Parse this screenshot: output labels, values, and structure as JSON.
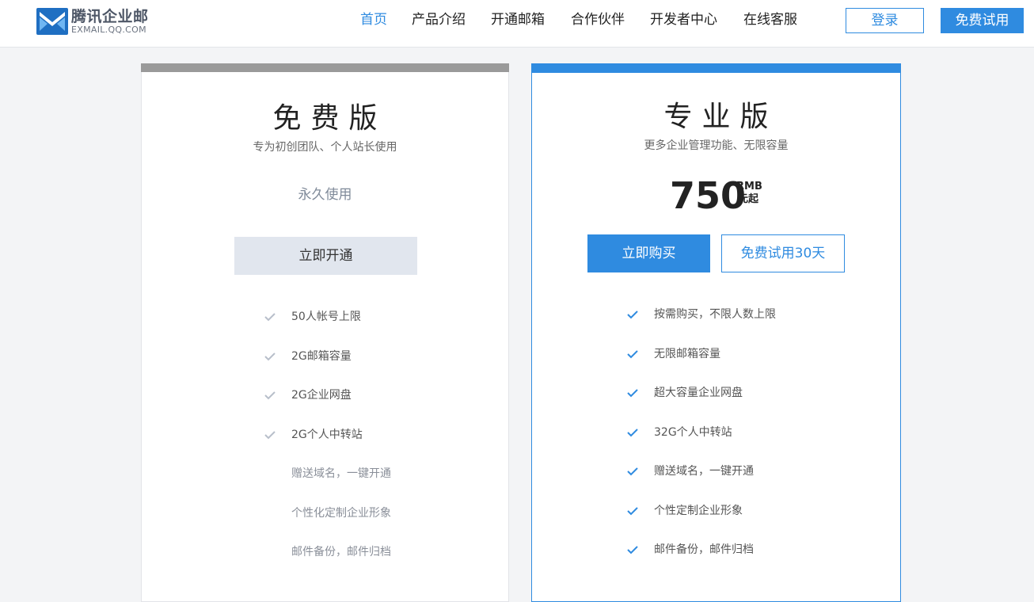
{
  "header": {
    "logo_cn": "腾讯企业邮",
    "logo_en": "EXMAIL.QQ.COM",
    "nav": [
      "首页",
      "产品介绍",
      "开通邮箱",
      "合作伙伴",
      "开发者中心",
      "在线客服"
    ],
    "login_label": "登录",
    "trial_label": "免费试用"
  },
  "free_plan": {
    "title": "免费版",
    "subtitle": "专为初创团队、个人站长使用",
    "term": "永久使用",
    "open_label": "立即开通",
    "features": [
      {
        "label": "50人帐号上限",
        "included": true
      },
      {
        "label": "2G邮箱容量",
        "included": true
      },
      {
        "label": "2G企业网盘",
        "included": true
      },
      {
        "label": "2G个人中转站",
        "included": true
      },
      {
        "label": "赠送域名，一键开通",
        "included": false
      },
      {
        "label": "个性化定制企业形象",
        "included": false
      },
      {
        "label": "邮件备份，邮件归档",
        "included": false
      }
    ]
  },
  "pro_plan": {
    "title": "专业版",
    "subtitle": "更多企业管理功能、无限容量",
    "price": "750",
    "currency": "RMB",
    "price_suffix": "元起",
    "buy_label": "立即购买",
    "trial_label": "免费试用30天",
    "features": [
      {
        "label": "按需购买，不限人数上限",
        "included": true
      },
      {
        "label": "无限邮箱容量",
        "included": true
      },
      {
        "label": "超大容量企业网盘",
        "included": true
      },
      {
        "label": "32G个人中转站",
        "included": true
      },
      {
        "label": "赠送域名，一键开通",
        "included": true
      },
      {
        "label": "个性定制企业形象",
        "included": true
      },
      {
        "label": "邮件备份，邮件归档",
        "included": true
      }
    ]
  },
  "colors": {
    "accent": "#2f8be0",
    "free_bar": "#9a9a9a",
    "check_gray": "#b8bfca"
  },
  "icons": {
    "logo": "exmail-logo-icon",
    "check": "check-icon"
  }
}
